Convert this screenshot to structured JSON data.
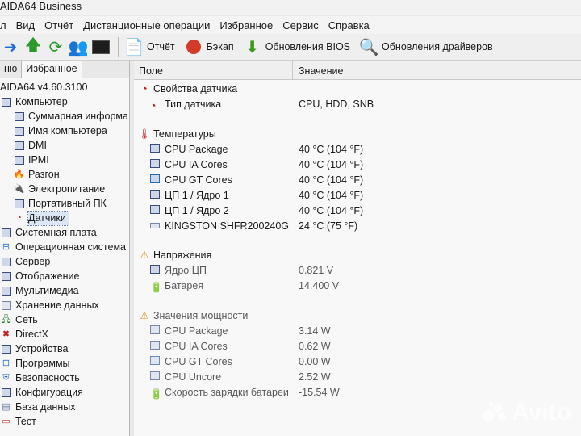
{
  "window": {
    "title": "AIDA64 Business"
  },
  "menu": [
    "л",
    "Вид",
    "Отчёт",
    "Дистанционные операции",
    "Избранное",
    "Сервис",
    "Справка"
  ],
  "toolbar": {
    "report": "Отчёт",
    "backup": "Бэкап",
    "bios_updates": "Обновления BIOS",
    "driver_updates": "Обновления драйверов"
  },
  "left_tabs": {
    "menu": "ню",
    "favorites": "Избранное"
  },
  "tree": {
    "version": "AIDA64 v4.60.3100",
    "computer": "Компьютер",
    "computer_children": [
      "Суммарная информа",
      "Имя компьютера",
      "DMI",
      "IPMI",
      "Разгон",
      "Электропитание",
      "Портативный ПК",
      "Датчики"
    ],
    "sections": [
      "Системная плата",
      "Операционная система",
      "Сервер",
      "Отображение",
      "Мультимедиа",
      "Хранение данных",
      "Сеть",
      "DirectX",
      "Устройства",
      "Программы",
      "Безопасность",
      "Конфигурация",
      "База данных",
      "Тест"
    ]
  },
  "columns": {
    "field": "Поле",
    "value": "Значение"
  },
  "groups": {
    "sensor_props": "Свойства датчика",
    "sensor_type_field": "Тип датчика",
    "sensor_type_value": "CPU, HDD, SNB",
    "temperatures": "Температуры",
    "temps": [
      {
        "field": "CPU Package",
        "value": "40 °C  (104 °F)"
      },
      {
        "field": "CPU IA Cores",
        "value": "40 °C  (104 °F)"
      },
      {
        "field": "CPU GT Cores",
        "value": "40 °C  (104 °F)"
      },
      {
        "field": "ЦП 1 / Ядро 1",
        "value": "40 °C  (104 °F)"
      },
      {
        "field": "ЦП 1 / Ядро 2",
        "value": "40 °C  (104 °F)"
      },
      {
        "field": "KINGSTON SHFR200240G",
        "value": "24 °C  (75 °F)"
      }
    ],
    "voltages": "Напряжения",
    "volts": [
      {
        "field": "Ядро ЦП",
        "value": "0.821 V"
      },
      {
        "field": "Батарея",
        "value": "14.400 V"
      }
    ],
    "power": "Значения мощности",
    "powers": [
      {
        "field": "CPU Package",
        "value": "3.14 W"
      },
      {
        "field": "CPU IA Cores",
        "value": "0.62 W"
      },
      {
        "field": "CPU GT Cores",
        "value": "0.00 W"
      },
      {
        "field": "CPU Uncore",
        "value": "2.52 W"
      },
      {
        "field": "Скорость зарядки батареи",
        "value": "-15.54 W"
      }
    ]
  },
  "watermark": "Avito"
}
